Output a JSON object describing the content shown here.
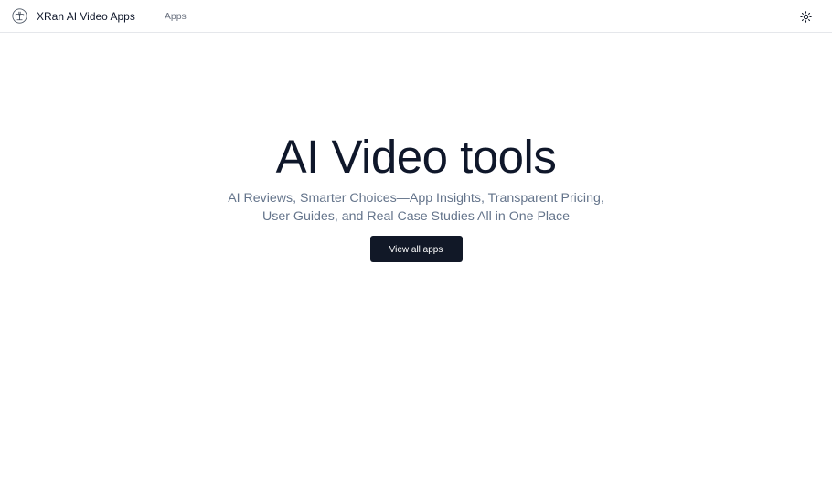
{
  "navbar": {
    "brand": {
      "name": "XRan AI Video Apps",
      "logo_icon": "palm-tree-logo-icon"
    },
    "links": [
      {
        "label": "Apps"
      }
    ],
    "theme_toggle_icon": "sun-icon"
  },
  "hero": {
    "title": "AI Video tools",
    "subtitle": "AI Reviews, Smarter Choices—App Insights, Transparent Pricing, User Guides, and Real Case Studies All in One Place",
    "cta_label": "View all apps"
  },
  "colors": {
    "primary_text": "#0f172a",
    "muted_text": "#64748b",
    "nav_link": "#6b7280",
    "button_bg": "#111827",
    "button_text": "#ffffff",
    "border": "#e5e7eb"
  }
}
